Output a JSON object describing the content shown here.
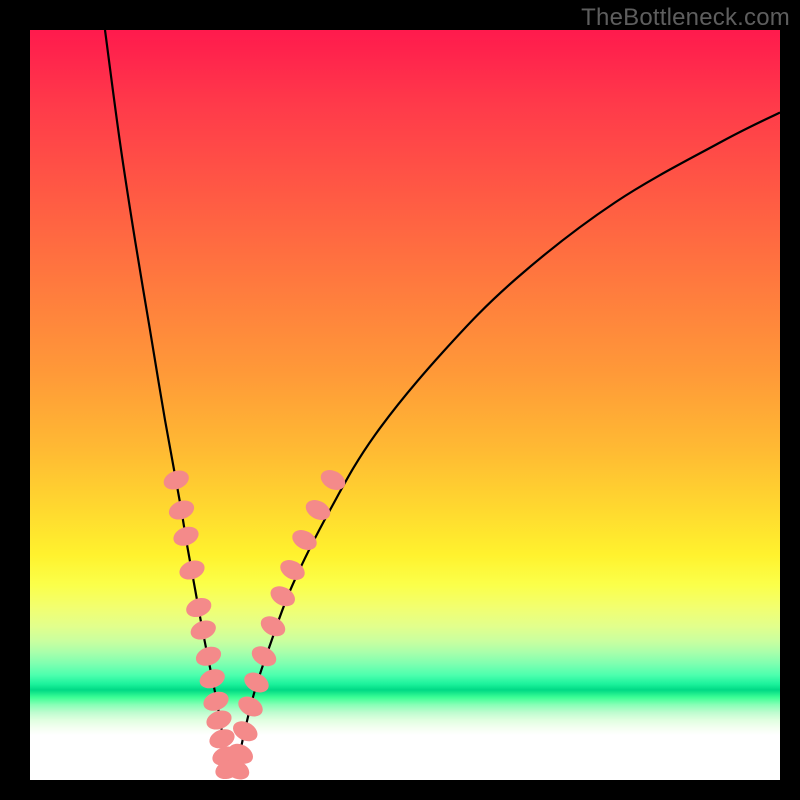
{
  "watermark": "TheBottleneck.com",
  "chart_data": {
    "type": "line",
    "title": "",
    "xlabel": "",
    "ylabel": "",
    "xlim": [
      0,
      100
    ],
    "ylim": [
      0,
      100
    ],
    "grid": false,
    "legend": false,
    "gradient_stops": [
      {
        "pos": 0,
        "color": "#ff1a4d"
      },
      {
        "pos": 50,
        "color": "#ff9a38"
      },
      {
        "pos": 72,
        "color": "#fff22e"
      },
      {
        "pos": 88,
        "color": "#00d985"
      },
      {
        "pos": 100,
        "color": "#ffffff"
      }
    ],
    "series": [
      {
        "name": "left-branch",
        "x": [
          10,
          12,
          14,
          16,
          18,
          20,
          21,
          22,
          23,
          24,
          25,
          25.8,
          26.2
        ],
        "y": [
          100,
          85,
          72,
          60,
          48,
          37,
          31,
          25.5,
          20,
          15,
          10,
          5,
          1
        ]
      },
      {
        "name": "right-branch",
        "x": [
          27.5,
          28.5,
          30,
          32,
          35,
          40,
          46,
          55,
          65,
          78,
          92,
          100
        ],
        "y": [
          1,
          6,
          12,
          18,
          26,
          36,
          46,
          57,
          67,
          77,
          85,
          89
        ]
      }
    ],
    "markers": [
      {
        "branch": "left",
        "x": 19.5,
        "y": 40
      },
      {
        "branch": "left",
        "x": 20.2,
        "y": 36
      },
      {
        "branch": "left",
        "x": 20.8,
        "y": 32.5
      },
      {
        "branch": "left",
        "x": 21.6,
        "y": 28
      },
      {
        "branch": "left",
        "x": 22.5,
        "y": 23
      },
      {
        "branch": "left",
        "x": 23.1,
        "y": 20
      },
      {
        "branch": "left",
        "x": 23.8,
        "y": 16.5
      },
      {
        "branch": "left",
        "x": 24.3,
        "y": 13.5
      },
      {
        "branch": "left",
        "x": 24.8,
        "y": 10.5
      },
      {
        "branch": "left",
        "x": 25.2,
        "y": 8
      },
      {
        "branch": "left",
        "x": 25.6,
        "y": 5.5
      },
      {
        "branch": "left",
        "x": 26.0,
        "y": 3.2
      },
      {
        "branch": "left",
        "x": 26.4,
        "y": 1.4
      },
      {
        "branch": "right",
        "x": 27.6,
        "y": 1.4
      },
      {
        "branch": "right",
        "x": 28.1,
        "y": 3.5
      },
      {
        "branch": "right",
        "x": 28.7,
        "y": 6.5
      },
      {
        "branch": "right",
        "x": 29.4,
        "y": 9.8
      },
      {
        "branch": "right",
        "x": 30.2,
        "y": 13
      },
      {
        "branch": "right",
        "x": 31.2,
        "y": 16.5
      },
      {
        "branch": "right",
        "x": 32.4,
        "y": 20.5
      },
      {
        "branch": "right",
        "x": 33.7,
        "y": 24.5
      },
      {
        "branch": "right",
        "x": 35.0,
        "y": 28
      },
      {
        "branch": "right",
        "x": 36.6,
        "y": 32
      },
      {
        "branch": "right",
        "x": 38.4,
        "y": 36
      },
      {
        "branch": "right",
        "x": 40.4,
        "y": 40
      }
    ],
    "marker_color": "#f48a8a",
    "curve_color": "#000000"
  }
}
